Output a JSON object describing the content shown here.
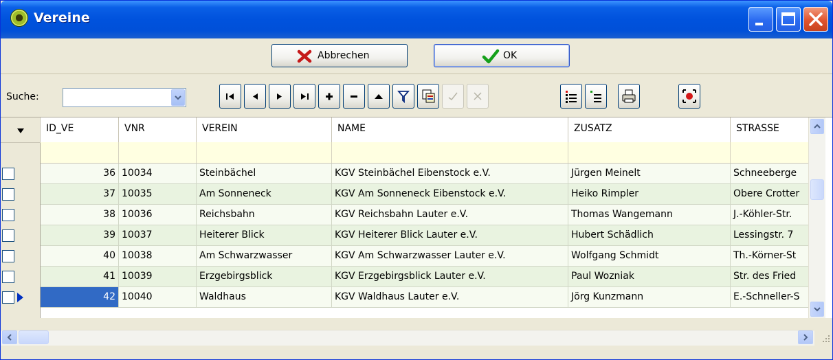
{
  "window": {
    "title": "Vereine",
    "icons": {
      "app": "club-emblem-icon",
      "minimize": "minimize-icon",
      "maximize": "maximize-icon",
      "close": "close-icon"
    }
  },
  "buttons": {
    "cancel_label": "Abbrechen",
    "ok_label": "OK"
  },
  "search": {
    "label": "Suche:",
    "value": ""
  },
  "navigator": [
    {
      "name": "first-record-button",
      "icon": "first-icon",
      "enabled": true
    },
    {
      "name": "prior-record-button",
      "icon": "prior-icon",
      "enabled": true
    },
    {
      "name": "next-record-button",
      "icon": "next-icon",
      "enabled": true
    },
    {
      "name": "last-record-button",
      "icon": "last-icon",
      "enabled": true
    },
    {
      "name": "insert-record-button",
      "icon": "plus-icon",
      "enabled": true
    },
    {
      "name": "delete-record-button",
      "icon": "minus-icon",
      "enabled": true
    },
    {
      "name": "edit-record-button",
      "icon": "up-icon",
      "enabled": true
    },
    {
      "name": "filter-button",
      "icon": "filter-icon",
      "enabled": true
    },
    {
      "name": "copy-button",
      "icon": "copy-icon",
      "enabled": true
    },
    {
      "name": "post-button",
      "icon": "check-icon",
      "enabled": false
    },
    {
      "name": "cancel-edit-button",
      "icon": "x-icon",
      "enabled": false
    },
    {
      "name": "insert-list-item-button",
      "icon": "list-insert-icon",
      "enabled": true
    },
    {
      "name": "append-list-item-button",
      "icon": "list-append-icon",
      "enabled": true
    },
    {
      "name": "print-button",
      "icon": "printer-icon",
      "enabled": true
    },
    {
      "name": "focus-button",
      "icon": "target-icon",
      "enabled": true
    }
  ],
  "grid": {
    "columns": [
      "ID_VE",
      "VNR",
      "VEREIN",
      "NAME",
      "ZUSATZ",
      "STRASSE"
    ],
    "rows": [
      {
        "id_ve": "36",
        "vnr": "10034",
        "verein": "Steinbächel",
        "name": "KGV Steinbächel Eibenstock e.V.",
        "zusatz": "Jürgen Meinelt",
        "strasse": "Schneeberge"
      },
      {
        "id_ve": "37",
        "vnr": "10035",
        "verein": "Am Sonneneck",
        "name": "KGV Am Sonneneck Eibenstock e.V.",
        "zusatz": "Heiko Rimpler",
        "strasse": "Obere Crotter"
      },
      {
        "id_ve": "38",
        "vnr": "10036",
        "verein": "Reichsbahn",
        "name": "KGV Reichsbahn Lauter e.V.",
        "zusatz": "Thomas Wangemann",
        "strasse": "J.-Köhler-Str."
      },
      {
        "id_ve": "39",
        "vnr": "10037",
        "verein": "Heiterer Blick",
        "name": "KGV Heiterer Blick Lauter e.V.",
        "zusatz": "Hubert Schädlich",
        "strasse": "Lessingstr. 7"
      },
      {
        "id_ve": "40",
        "vnr": "10038",
        "verein": "Am Schwarzwasser",
        "name": "KGV Am Schwarzwasser Lauter e.V.",
        "zusatz": "Wolfgang Schmidt",
        "strasse": "Th.-Körner-St"
      },
      {
        "id_ve": "41",
        "vnr": "10039",
        "verein": "Erzgebirgsblick",
        "name": "KGV Erzgebirgsblick Lauter e.V.",
        "zusatz": "Paul Wozniak",
        "strasse": "Str. des Fried"
      },
      {
        "id_ve": "42",
        "vnr": "10040",
        "verein": "Waldhaus",
        "name": "KGV Waldhaus Lauter e.V.",
        "zusatz": "Jörg Kunzmann",
        "strasse": "E.-Schneller-S"
      }
    ],
    "selected_row": 6
  },
  "colors": {
    "row_alt": "#e9f3e0",
    "row": "#f7fbf1",
    "selected_cell": "#316ac5",
    "filter_row": "#ffffe1"
  }
}
